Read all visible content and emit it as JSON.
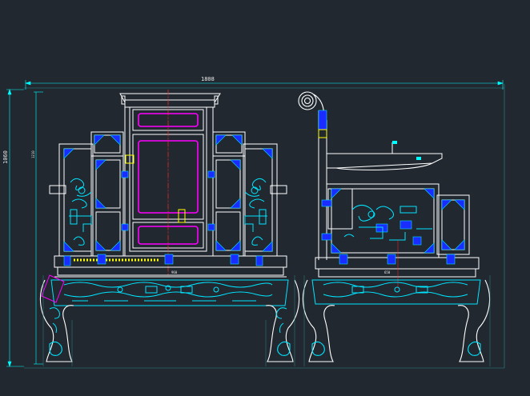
{
  "drawing": {
    "background": "#212830",
    "colors": {
      "outline": "#ffffff",
      "ornament": "#00e5ff",
      "panel": "#ff00ff",
      "dimension": "#00ffff",
      "fill": "#1a2cff",
      "centerline": "#ff2a2a",
      "highlight": "#ffff00",
      "frame": "#2a8a8a"
    },
    "dimensions": {
      "overall_width": "1808",
      "overall_height": "1060",
      "inner_height": "1210",
      "front_seat_width": "960",
      "side_seat_width": "650"
    }
  }
}
